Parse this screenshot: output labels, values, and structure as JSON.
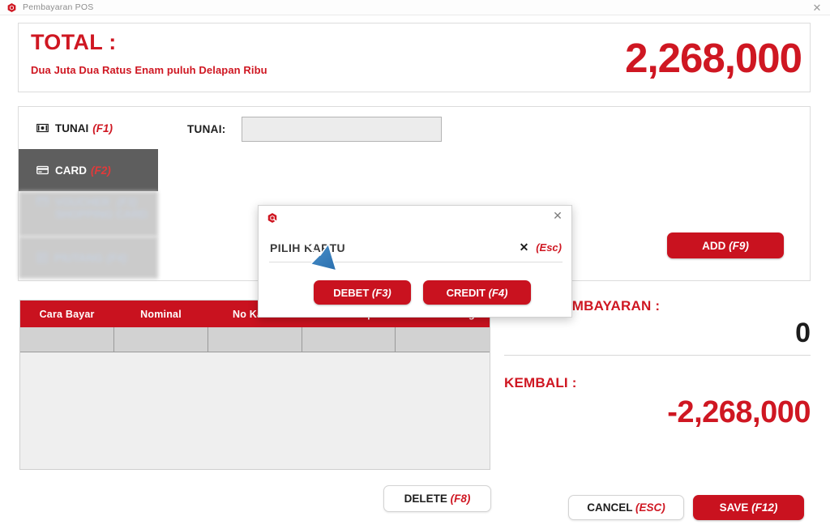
{
  "window": {
    "title": "Pembayaran POS",
    "logo_icon": "hexagon-logo-icon",
    "close_icon": "close-icon"
  },
  "total_panel": {
    "label": "TOTAL :",
    "words": "Dua Juta Dua Ratus Enam puluh Delapan Ribu",
    "amount": "2,268,000",
    "accent_color": "#cf1722"
  },
  "payment_methods": {
    "items": [
      {
        "label": "TUNAI",
        "shortcut": "(F1)",
        "icon": "banknote-icon",
        "state": "normal"
      },
      {
        "label": "CARD",
        "shortcut": "(F2)",
        "icon": "credit-card-icon",
        "state": "active"
      },
      {
        "label": "VOUCHER",
        "shortcut": "(F3)",
        "sub": "SHOPPING CARD",
        "icon": "voucher-icon",
        "state": "dimmed"
      },
      {
        "label": "PIUTANG",
        "shortcut": "(F4)",
        "icon": "invoice-icon",
        "state": "dimmed"
      }
    ]
  },
  "tunai_field": {
    "label": "TUNAI:",
    "value": "",
    "placeholder": ""
  },
  "add_button": {
    "label": "ADD",
    "shortcut": "(F9)"
  },
  "table": {
    "headers": [
      "Cara Bayar",
      "Nominal",
      "No Kartu",
      "Saldo.Exp",
      "Nilai Surcharge"
    ],
    "rows": [
      [
        "",
        "",
        "",
        "",
        ""
      ]
    ]
  },
  "summary": {
    "payment_label": "TOTAL PEMBAYARAN :",
    "payment_value": "0",
    "change_label": "KEMBALI :",
    "change_value": "-2,268,000"
  },
  "footer_buttons": {
    "delete": {
      "label": "DELETE",
      "shortcut": "(F8)"
    },
    "cancel": {
      "label": "CANCEL",
      "shortcut": "(ESC)"
    },
    "save": {
      "label": "SAVE",
      "shortcut": "(F12)"
    }
  },
  "modal": {
    "logo_icon": "hexagon-logo-icon",
    "close_icon": "close-icon",
    "title": "PILIH KARTU",
    "esc_mark": "✕",
    "esc_label": "(Esc)",
    "buttons": [
      {
        "label": "DEBET",
        "shortcut": "(F3)"
      },
      {
        "label": "CREDIT",
        "shortcut": "(F4)"
      }
    ]
  },
  "annotation": {
    "arrow_icon": "blue-arrow-pointer",
    "color": "#3f8fd0"
  }
}
